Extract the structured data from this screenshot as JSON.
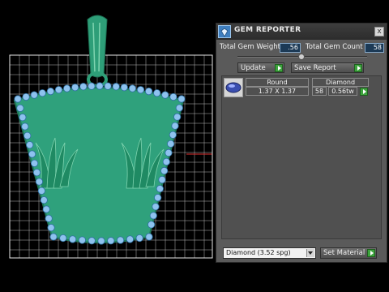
{
  "colors": {
    "viewport_bg": "#000000",
    "grid": "#cfcfcf",
    "model": "#2e9e78",
    "gems": "#8ec2ee",
    "panel_bg": "#5a5a5a",
    "accent_play": "#3da43d"
  },
  "panel": {
    "title": "GEM REPORTER",
    "close_symbol": "x",
    "weight_label": "Total Gem Weight",
    "weight_value": ".56",
    "count_label": "Total Gem Count",
    "count_value": "58",
    "update_label": "Update",
    "save_report_label": "Save Report"
  },
  "gem_list": {
    "rows": [
      {
        "icon": "round-gem-icon",
        "shape": "Round",
        "size": "1.37 X 1.37",
        "count": "58",
        "material": "Diamond",
        "weight": "0.56tw"
      }
    ]
  },
  "material": {
    "selected": "Diamond     (3.52 spg)",
    "set_label": "Set Material"
  }
}
